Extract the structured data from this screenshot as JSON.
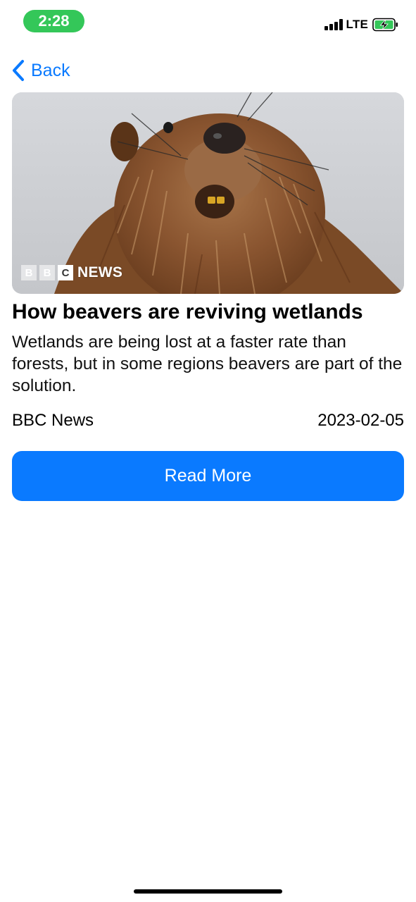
{
  "status_bar": {
    "time": "2:28",
    "network": "LTE",
    "icons": [
      "signal-bars-icon",
      "battery-charging-icon"
    ],
    "time_pill_color": "#34c759"
  },
  "nav": {
    "back_label": "Back",
    "back_icon": "chevron-left-icon",
    "accent_color": "#0a7aff"
  },
  "article": {
    "image_logo": {
      "boxes": [
        "B",
        "B",
        "C"
      ],
      "text": "NEWS"
    },
    "title": "How beavers are reviving wetlands",
    "summary": "Wetlands are being lost at a faster rate than forests, but in some regions beavers are part of the solution.",
    "source": "BBC News",
    "date": "2023-02-05",
    "read_more_label": "Read More",
    "button_color": "#0a7aff"
  }
}
